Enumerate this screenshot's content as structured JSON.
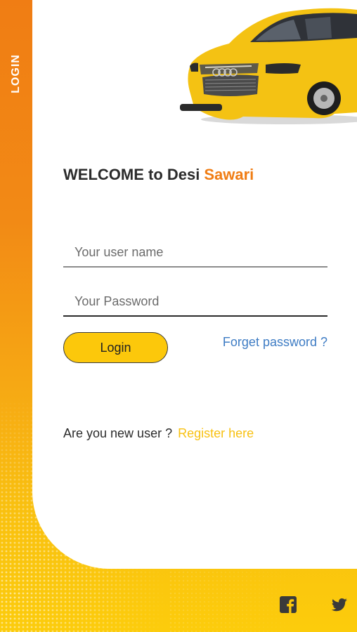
{
  "side_tab": {
    "label": "LOGIN"
  },
  "welcome": {
    "prefix": "WELCOME to Desi",
    "brand": "Sawari"
  },
  "form": {
    "username_placeholder": "Your user name",
    "password_placeholder": "Your Password",
    "login_label": "Login",
    "forgot_label": "Forget password ?"
  },
  "register": {
    "prompt": "Are you new user ?",
    "link": "Register here"
  },
  "social": [
    "facebook-icon",
    "twitter-icon"
  ],
  "colors": {
    "orange": "#f07d14",
    "yellow": "#fcc80b",
    "link_blue": "#3e7cc4",
    "register_yellow": "#f8c112"
  }
}
